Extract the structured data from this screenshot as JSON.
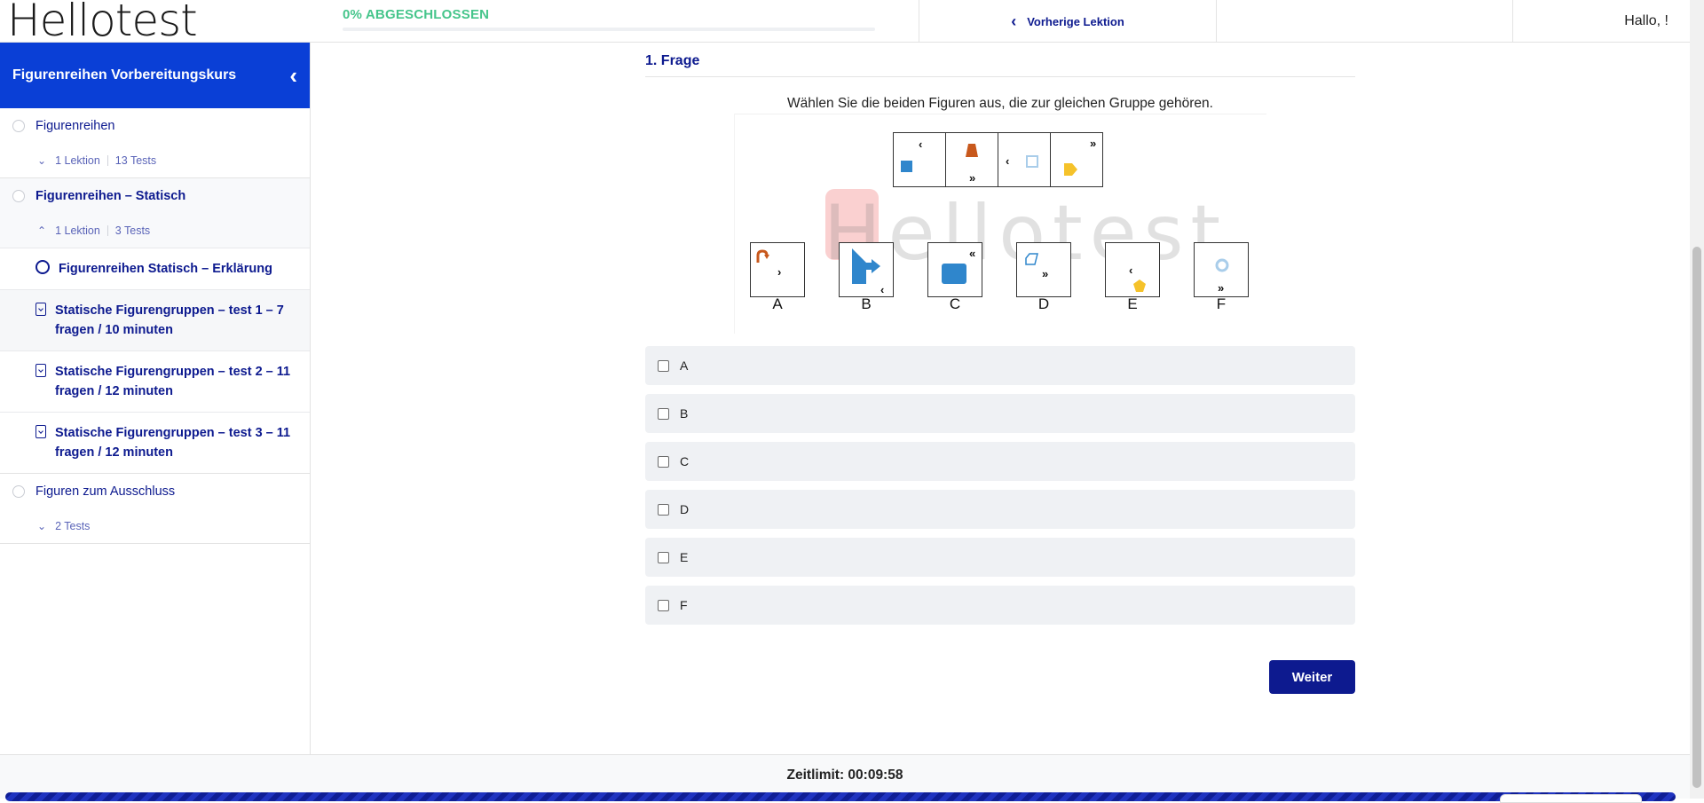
{
  "header": {
    "logo_text": "Hellotest",
    "logo_underscore": "_",
    "progress_label": "0% ABGESCHLOSSEN",
    "progress_fraction": 0,
    "prev_lesson_label": "Vorherige Lektion",
    "greeting": "Hallo, !"
  },
  "sidebar": {
    "course_title": "Figurenreihen Vorbereitungskurs",
    "modules": [
      {
        "title": "Figurenreihen",
        "meta": [
          "1 Lektion",
          "13 Tests"
        ]
      },
      {
        "title": "Figurenreihen – Statisch",
        "meta": [
          "1 Lektion",
          "3 Tests"
        ],
        "lessons": [
          "Figurenreihen Statisch – Erklärung",
          "Statische Figurengruppen – test 1 – 7 fragen / 10 minuten",
          "Statische Figurengruppen – test 2 – 11 fragen / 12 minuten",
          "Statische Figurengruppen – test 3 – 11 fragen / 12 minuten"
        ]
      },
      {
        "title": "Figuren zum Ausschluss",
        "meta": [
          "2 Tests"
        ]
      }
    ]
  },
  "question": {
    "heading": "1. Frage",
    "prompt": "Wählen Sie die beiden Figuren aus, die zur gleichen Gruppe gehören.",
    "watermark": "Hellotest",
    "figure_labels": [
      "A",
      "B",
      "C",
      "D",
      "E",
      "F"
    ],
    "glyphs": {
      "single_left": "‹",
      "single_right": "›",
      "double_left": "«",
      "double_right": "»"
    },
    "answers": [
      "A",
      "B",
      "C",
      "D",
      "E",
      "F"
    ],
    "next_label": "Weiter"
  },
  "footer": {
    "timer": "Zeitlimit: 00:09:58"
  },
  "colors": {
    "brand_blue": "#0a3fd6",
    "navy": "#0d1a8f",
    "green": "#46c58b",
    "shape_blue": "#2f86cc",
    "shape_orange": "#c8581c",
    "shape_yellow": "#f5c22a",
    "shape_lightblue": "#a9cdea"
  }
}
